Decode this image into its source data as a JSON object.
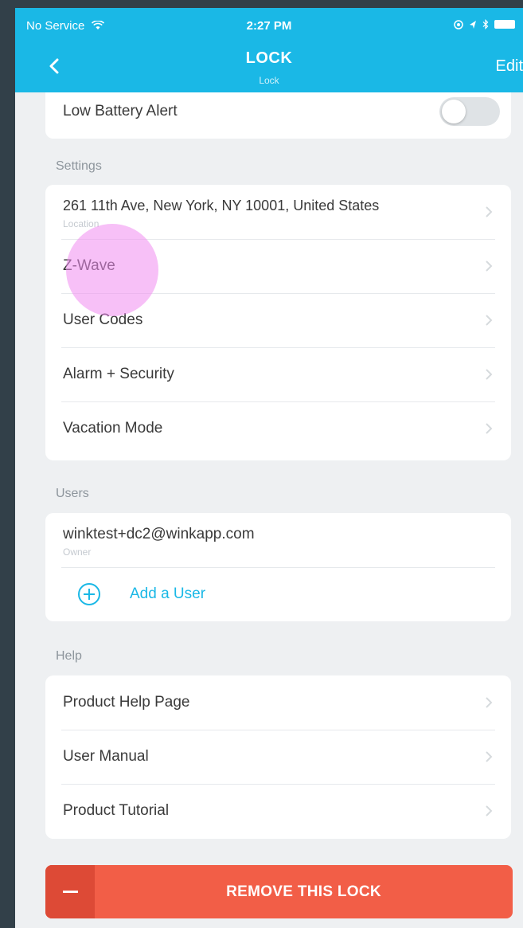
{
  "status_bar": {
    "carrier": "No Service",
    "time": "2:27 PM"
  },
  "nav": {
    "title": "LOCK",
    "subtitle": "Lock",
    "edit": "Edit"
  },
  "top_card": {
    "low_battery_label": "Low Battery Alert",
    "low_battery_on": false
  },
  "settings": {
    "label": "Settings",
    "location": {
      "value": "261 11th Ave, New York, NY  10001, United States",
      "caption": "Location"
    },
    "items": [
      "Z-Wave",
      "User Codes",
      "Alarm + Security",
      "Vacation Mode"
    ]
  },
  "users": {
    "label": "Users",
    "owner_email": "winktest+dc2@winkapp.com",
    "owner_role": "Owner",
    "add_user": "Add a User"
  },
  "help": {
    "label": "Help",
    "items": [
      "Product Help Page",
      "User Manual",
      "Product Tutorial"
    ]
  },
  "remove_button": "REMOVE THIS LOCK",
  "colors": {
    "accent": "#1ab8e6",
    "danger": "#f25e47",
    "danger_dark": "#dd4a36",
    "background": "#eef0f2",
    "frame": "#324049"
  },
  "icons": [
    "wifi-icon",
    "location-icon",
    "bluetooth-icon",
    "battery-icon",
    "back-chevron-icon",
    "chevron-right-icon",
    "plus-circle-icon",
    "minus-icon"
  ]
}
